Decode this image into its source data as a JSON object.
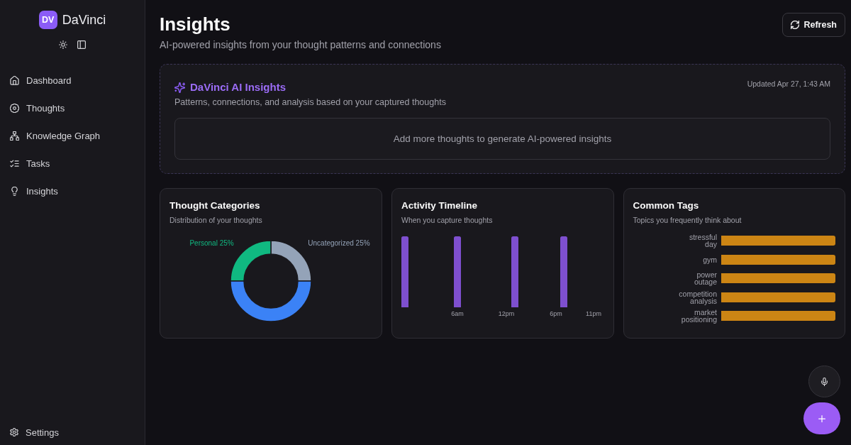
{
  "sidebar": {
    "logo": {
      "initials": "DV",
      "name": "DaVinci"
    },
    "nav_items": [
      {
        "label": "Dashboard"
      },
      {
        "label": "Thoughts"
      },
      {
        "label": "Knowledge Graph"
      },
      {
        "label": "Tasks"
      },
      {
        "label": "Insights"
      }
    ],
    "settings": {
      "label": "Settings"
    }
  },
  "header": {
    "title": "Insights",
    "subtitle": "AI-powered insights from your thought patterns and connections",
    "refresh_button": "Refresh"
  },
  "ai_insights": {
    "title": "DaVinci AI Insights",
    "updated": "Updated Apr 27, 1:43 AM",
    "description": "Patterns, connections, and analysis based on your captured thoughts",
    "empty_message": "Add more thoughts to generate AI-powered insights"
  },
  "thought_categories": {
    "title": "Thought Categories",
    "subtitle": "Distribution of your thoughts",
    "chart_data": {
      "type": "donut",
      "values": [
        25,
        25,
        50
      ],
      "colors": [
        "#94a3b8",
        "#10b981",
        "#3b82f6"
      ],
      "value_labels": [
        "Uncategorized 25%",
        "Personal 25%",
        null
      ]
    }
  },
  "activity_timeline": {
    "title": "Activity Timeline",
    "subtitle": "When you capture thoughts",
    "x_labels": [
      "6am",
      "12pm",
      "6pm",
      "11pm"
    ]
  },
  "common_tags": {
    "title": "Common Tags",
    "subtitle": "Topics you frequently think about",
    "tags": [
      "stressful day",
      "gym",
      "power outage",
      "competition analysis",
      "market positioning"
    ]
  }
}
